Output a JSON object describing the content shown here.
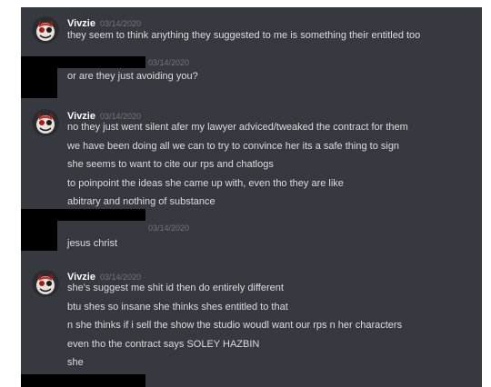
{
  "colors": {
    "background": "#36393f",
    "author": "#ffffff",
    "text": "#dcddde",
    "timestamp": "#72767d",
    "redaction": "#000000"
  },
  "messages": [
    {
      "author": "Vivzie",
      "timestamp": "03/14/2020",
      "avatar_icon": "demon-avatar-icon",
      "lines": [
        "they seem to think anything they suggested to me is something their entitled too"
      ]
    },
    {
      "author": "",
      "timestamp": "03/14/2020",
      "redacted_author": true,
      "lines": [
        "or are they just avoiding you?"
      ]
    },
    {
      "author": "Vivzie",
      "timestamp": "03/14/2020",
      "avatar_icon": "demon-avatar-icon",
      "lines": [
        "no they just went silent afer my lawyer adviced/tweaked the contract for them",
        "we have been doing all we can to try to convince her its a safe thing to sign",
        "she seems to want to cite our rps and chatlogs",
        "to poinpoint the ideas she came up with, even tho they are like",
        "abitrary and nothing of substance"
      ]
    },
    {
      "author": "",
      "timestamp": "03/14/2020",
      "redacted_author": true,
      "lines": [
        "jesus christ"
      ]
    },
    {
      "author": "Vivzie",
      "timestamp": "03/14/2020",
      "avatar_icon": "demon-avatar-icon",
      "lines": [
        "she's suggest me shit id then do entirely different",
        "btu shes so insane she thinks shes entitled to that",
        "n she thinks if i sell the show the studio woudl want our rps n her characters",
        "even tho the contract says SOLEY HAZBIN",
        "she"
      ]
    }
  ]
}
